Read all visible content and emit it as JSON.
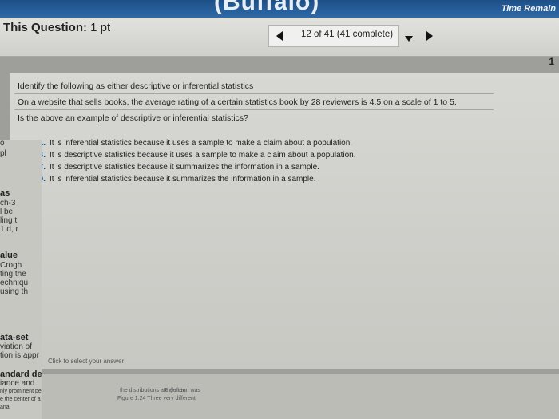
{
  "top": {
    "course_title": "(Buffalo)",
    "time_label": "Time Remain"
  },
  "question_header": {
    "title_bold": "This Question:",
    "title_pts": " 1 pt",
    "progress": "12 of 41 (41 complete)",
    "corner_num": "1"
  },
  "question": {
    "instruction": "Identify the following as either descriptive or inferential statistics",
    "scenario": "On a website that sells books, the average rating of a certain statistics book by 28 reviewers is 4.5 on a scale of 1 to 5.",
    "prompt": "Is the above an example of descriptive or inferential statistics?",
    "selected": "A",
    "options": [
      {
        "letter": "A.",
        "text": "It is inferential statistics because it uses a sample to make a claim about a population."
      },
      {
        "letter": "B.",
        "text": "It is descriptive statistics because it uses a sample to make a claim about a population."
      },
      {
        "letter": "C.",
        "text": "It is descriptive statistics because it summarizes the information in a sample."
      },
      {
        "letter": "D.",
        "text": "It is inferential statistics because it summarizes the information in a sample."
      }
    ],
    "hint": "Click to select your answer"
  },
  "sidebar_fragments": [
    "o",
    "pl",
    "as",
    "ch-3",
    "l be",
    "ling t",
    "1 d, r",
    "alue",
    "Crogh",
    "ting the",
    "echniqu",
    "using th",
    "ata-set",
    "viation of",
    "tion is appr",
    "andard de",
    "iance and",
    "nly prominent peaks",
    "e the center of a data set, but the",
    "ana"
  ],
  "footer_fragments": [
    "the distributions are (left to",
    "The mean was",
    "Figure 1.24  Three very different"
  ]
}
